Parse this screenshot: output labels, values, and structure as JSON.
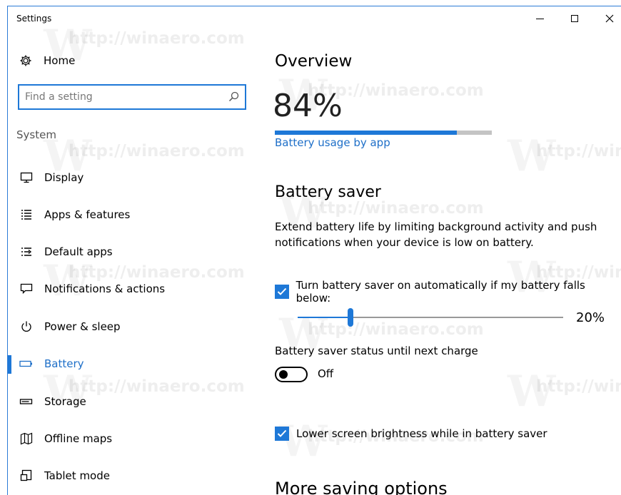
{
  "window": {
    "title": "Settings",
    "controls": {
      "minimize": "minimize",
      "maximize": "maximize",
      "close": "close"
    }
  },
  "sidebar": {
    "home_label": "Home",
    "search_placeholder": "Find a setting",
    "section": "System",
    "items": [
      {
        "label": "Display",
        "icon": "display-icon",
        "active": false
      },
      {
        "label": "Apps & features",
        "icon": "apps-features-icon",
        "active": false
      },
      {
        "label": "Default apps",
        "icon": "default-apps-icon",
        "active": false
      },
      {
        "label": "Notifications & actions",
        "icon": "notifications-icon",
        "active": false
      },
      {
        "label": "Power & sleep",
        "icon": "power-icon",
        "active": false
      },
      {
        "label": "Battery",
        "icon": "battery-icon",
        "active": true
      },
      {
        "label": "Storage",
        "icon": "storage-icon",
        "active": false
      },
      {
        "label": "Offline maps",
        "icon": "map-icon",
        "active": false
      },
      {
        "label": "Tablet mode",
        "icon": "tablet-mode-icon",
        "active": false
      }
    ]
  },
  "main": {
    "overview": {
      "heading": "Overview",
      "percent_text": "84%",
      "battery_level": 0.84,
      "link_label": "Battery usage by app"
    },
    "battery_saver": {
      "heading": "Battery saver",
      "description": "Extend battery life by limiting background activity and push notifications when your device is low on battery.",
      "auto_checkbox_label": "Turn battery saver on automatically if my battery falls below:",
      "auto_checked": true,
      "threshold_value": 0.2,
      "threshold_text": "20%",
      "status_label": "Battery saver status until next charge",
      "toggle_state": "Off",
      "brightness_checkbox_label": "Lower screen brightness while in battery saver",
      "brightness_checked": true
    },
    "more": {
      "heading": "More saving options"
    }
  },
  "watermark": {
    "text": "http://winaero.com",
    "letter": "W"
  },
  "colors": {
    "accent": "#1e78d7",
    "link": "#1e6fc8",
    "progress_track": "#c4c4c4"
  }
}
